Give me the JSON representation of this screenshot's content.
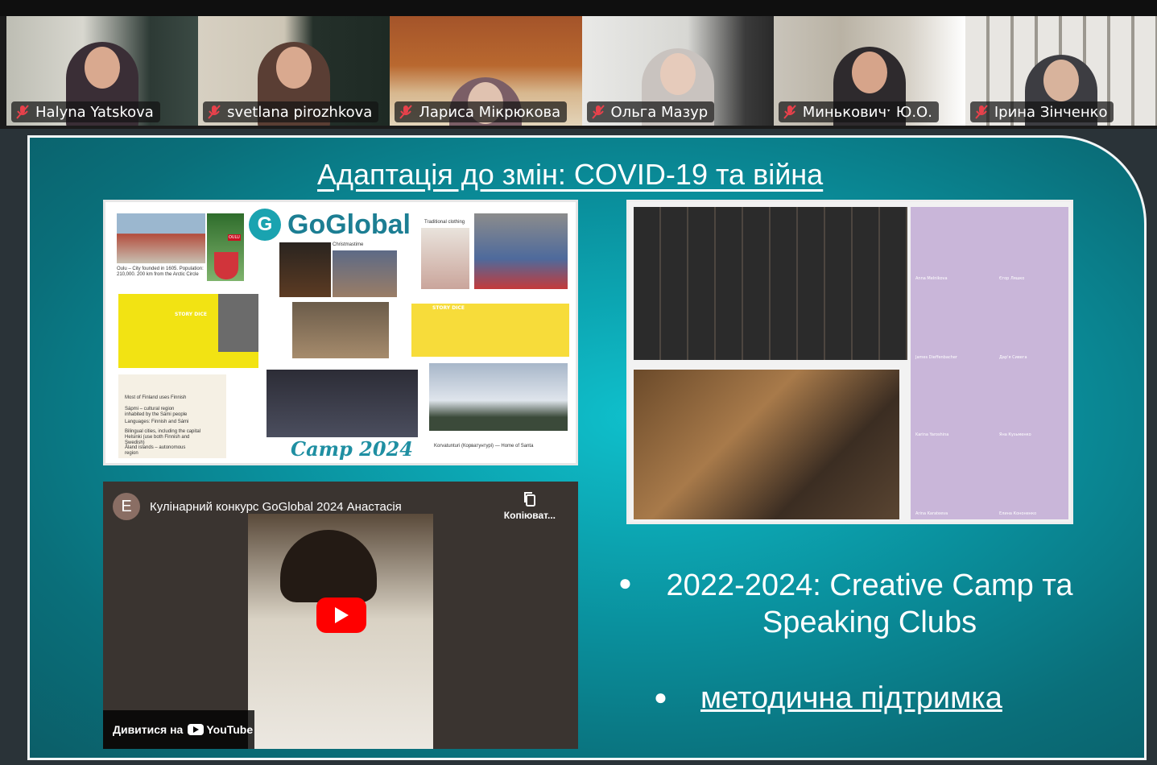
{
  "participants": [
    {
      "name": "Halyna Yatskova",
      "muted": true
    },
    {
      "name": "svetlana pirozhkova",
      "muted": true
    },
    {
      "name": "Лариса Мікрюкова",
      "muted": true
    },
    {
      "name": "Ольга Мазур",
      "muted": true
    },
    {
      "name": "Миньковичˑ Ю.О.",
      "muted": true
    },
    {
      "name": "Ірина Зінченко",
      "muted": true
    }
  ],
  "slide": {
    "title": "Адаптація до змін: COVID-19 та війна",
    "collage": {
      "logo_letter": "G",
      "logo_text": "GoGlobal",
      "camp_label": "Camp 2024",
      "oulu_caption": "Oulu – City founded in 1605. Population: 210,000. 200 km from the Arctic Circle",
      "oulu_badge": "OULU",
      "christmastime": "Christmastime",
      "traditional_clothing": "Traditional clothing",
      "story_dice": "STORY DICE",
      "story_dice_2": "STORY DICE",
      "map_lines": [
        "Most of Finland uses Finnish",
        "Sápmi – cultural region inhabited by the Sámi people",
        "Languages: Finnish and Sámi",
        "Bilingual cities, including the capital Helsinki (use both Finnish and Swedish)",
        "Åland islands – autonomous region"
      ],
      "korvatunturi": "Korvatunturi (Корватунтурі) — Home of Santa"
    },
    "video": {
      "avatar_letter": "E",
      "title": "Кулінарний конкурс GoGlobal 2024 Анастасія",
      "copy_label": "Копіюват...",
      "watch_on": "Дивитися на",
      "youtube": "YouTube"
    },
    "bullets": [
      "2022-2024: Creative Camp та Speaking Clubs",
      "методична підтримка"
    ]
  },
  "zoom_labels": [
    "Anna Melnikova",
    "Єгор Ляшко",
    "James Dieffenbacher",
    "Дар'я Сивега",
    "Karina Yaroshina",
    "Яна Кузьменко",
    "Arina Karateeva",
    "Елина Кононенко"
  ],
  "colors": {
    "slide_teal": "#0a8f9c",
    "title_white": "#ffffff",
    "logo_blue": "#1c7e93",
    "youtube_red": "#ff0000"
  }
}
